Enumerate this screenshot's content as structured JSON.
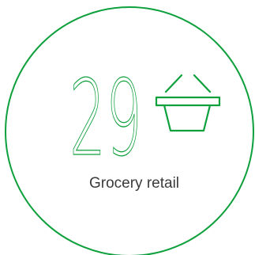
{
  "stat": {
    "number": "29",
    "label": "Grocery retail",
    "icon": "shopping-basket-icon"
  },
  "colors": {
    "accent": "#0da03c",
    "label_text": "#3a3a3a",
    "background": "#ffffff"
  }
}
